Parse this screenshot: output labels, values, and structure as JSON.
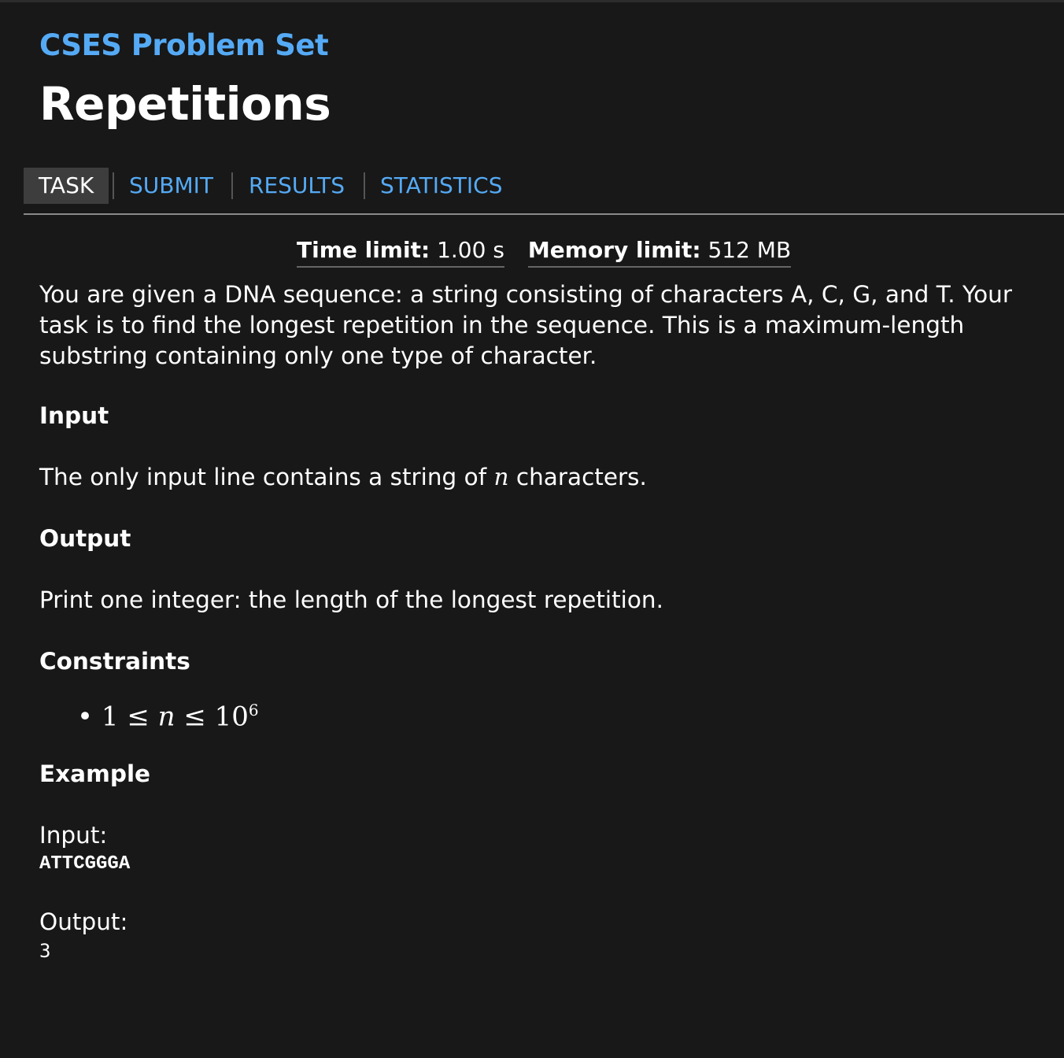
{
  "header": {
    "site": "CSES Problem Set",
    "title": "Repetitions"
  },
  "tabs": [
    {
      "label": "TASK"
    },
    {
      "label": "SUBMIT"
    },
    {
      "label": "RESULTS"
    },
    {
      "label": "STATISTICS"
    }
  ],
  "limits": {
    "time_label": "Time limit:",
    "time_value": "1.00 s",
    "memory_label": "Memory limit:",
    "memory_value": "512 MB"
  },
  "statement": "You are given a DNA sequence: a string consisting of characters A, C, G, and T. Your task is to find the longest repetition in the sequence. This is a maximum-length substring containing only one type of character.",
  "input": {
    "heading": "Input",
    "text_before": "The only input line contains a string of",
    "var": "n",
    "text_after": "characters."
  },
  "output": {
    "heading": "Output",
    "text": "Print one integer: the length of the longest repetition."
  },
  "constraints": {
    "heading": "Constraints",
    "items": [
      "1 ≤ n ≤ 10^6"
    ],
    "lhs": "1 ≤",
    "var": "n",
    "rhs": "≤ 10",
    "exp": "6"
  },
  "example": {
    "heading": "Example",
    "input_label": "Input:",
    "input_value": "ATTCGGGA",
    "output_label": "Output:",
    "output_value": "3"
  }
}
